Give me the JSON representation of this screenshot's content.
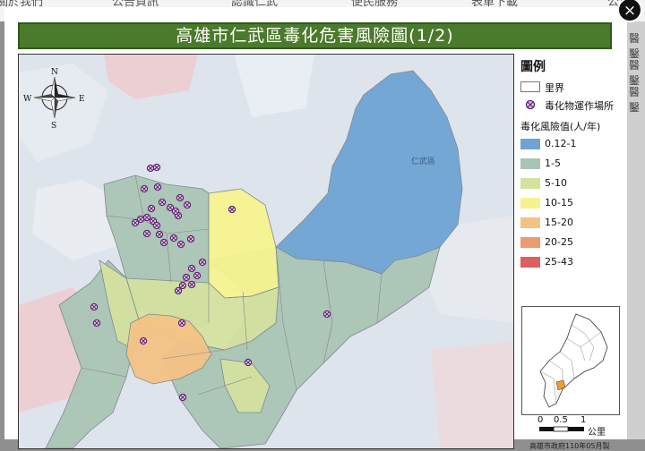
{
  "background_nav": [
    "關於我們",
    "公告資訊",
    "認識仁武",
    "便民服務",
    "表單下載",
    "公用"
  ],
  "background_side": [
    "醫鑿",
    "醫鑿",
    "醫鑿"
  ],
  "modal": {
    "close_symbol": "×",
    "title": "高雄市仁武區毒化危害風險圖(1/2)"
  },
  "map": {
    "district_label": "仁武區",
    "compass": {
      "n": "N",
      "s": "S",
      "e": "E",
      "w": "W"
    }
  },
  "legend": {
    "title": "圖例",
    "boundary_label": "里界",
    "site_label": "毒化物運作場所",
    "risk_title": "毒化風險值(人/年)",
    "classes": [
      {
        "label": "0.12-1",
        "color": "#6fa3d4"
      },
      {
        "label": "1-5",
        "color": "#a9c4b4"
      },
      {
        "label": "5-10",
        "color": "#d3e29f"
      },
      {
        "label": "10-15",
        "color": "#f6f38f"
      },
      {
        "label": "15-20",
        "color": "#f3c285"
      },
      {
        "label": "20-25",
        "color": "#ec9a6f"
      },
      {
        "label": "25-43",
        "color": "#de5f5f"
      }
    ],
    "site_color": "#9a3fa8",
    "scale": {
      "t0": "0",
      "t1": "0.5",
      "t2": "1",
      "unit": "公里"
    },
    "credit": "高雄市政府110年05月製"
  }
}
